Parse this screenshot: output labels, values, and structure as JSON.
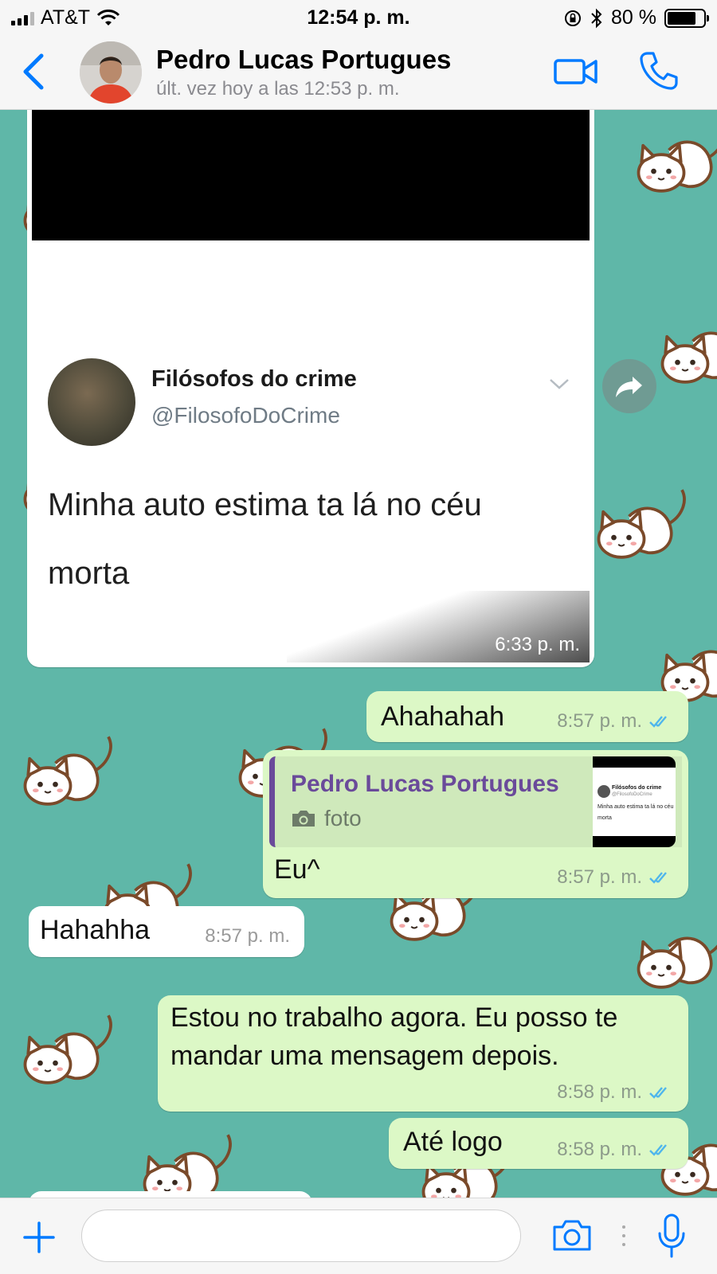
{
  "status_bar": {
    "carrier": "AT&T",
    "time": "12:54 p. m.",
    "battery": "80 %"
  },
  "header": {
    "contact_name": "Pedro Lucas Portugues",
    "last_seen": "últ. vez hoy a las 12:53 p. m."
  },
  "messages": [
    {
      "id": "image-message",
      "direction": "incoming",
      "type": "image",
      "tweet": {
        "name": "Filósofos do crime",
        "handle": "@FilosofoDoCrime",
        "text_line1": "Minha auto estima ta lá no céu",
        "text_line2": "morta"
      },
      "time": "6:33 p. m."
    },
    {
      "id": "msg-ahahahah",
      "direction": "outgoing",
      "text": "Ahahahah",
      "time": "8:57 p. m."
    },
    {
      "id": "msg-eu",
      "direction": "outgoing",
      "quote": {
        "author": "Pedro Lucas Portugues",
        "label": "foto",
        "thumb_name": "Filósofos do crime",
        "thumb_handle": "@FilosofoDoCrime",
        "thumb_line1": "Minha auto estima ta lá no céu",
        "thumb_line2": "morta"
      },
      "text": "Eu^",
      "time": "8:57 p. m."
    },
    {
      "id": "msg-hahahha",
      "direction": "incoming",
      "text": "Hahahha",
      "time": "8:57 p. m."
    },
    {
      "id": "msg-trabalho",
      "direction": "outgoing",
      "text_line1": "Estou no trabalho agora. Eu posso te",
      "text_line2": "mandar uma mensagem depois.",
      "time": "8:58 p. m."
    },
    {
      "id": "msg-ate-logo",
      "direction": "outgoing",
      "text": "Até logo",
      "time": "8:58 p. m."
    }
  ],
  "input_bar": {
    "message_value": ""
  },
  "colors": {
    "accent": "#007aff",
    "chat_background": "#5fb7a8",
    "outgoing_bubble": "#dcf8c6",
    "incoming_bubble": "#ffffff",
    "read_ticks": "#4fb6ec",
    "quote_author": "#6a4a9a"
  },
  "icons": [
    "signal-icon",
    "wifi-icon",
    "orientation-lock-icon",
    "bluetooth-icon",
    "battery-icon",
    "back-chevron-icon",
    "video-call-icon",
    "phone-icon",
    "forward-icon",
    "camera-icon",
    "double-check-icon",
    "plus-icon",
    "microphone-icon"
  ]
}
